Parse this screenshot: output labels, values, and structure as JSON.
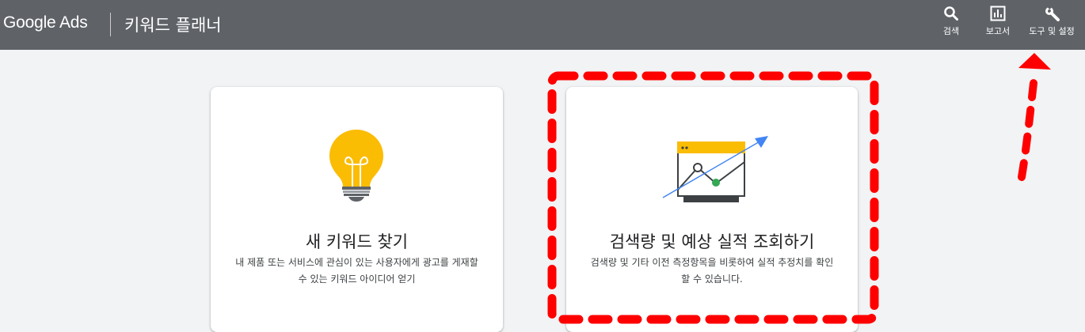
{
  "header": {
    "brand": "Google Ads",
    "section_title": "키워드 플래너",
    "tools": [
      {
        "label": "검색",
        "icon": "search-icon"
      },
      {
        "label": "보고서",
        "icon": "bar-chart-icon"
      },
      {
        "label": "도구 및 설정",
        "icon": "wrench-icon"
      }
    ]
  },
  "cards": [
    {
      "title": "새 키워드 찾기",
      "description": "내 제품 또는 서비스에 관심이 있는 사용자에게 광고를 게재할 수 있는 키워드 아이디어 얻기",
      "icon": "lightbulb-icon"
    },
    {
      "title": "검색량 및 예상 실적 조회하기",
      "description": "검색량 및 기타 이전 측정항목을 비롯하여 실적 추정치를 확인할 수 있습니다.",
      "icon": "trend-chart-icon"
    }
  ],
  "annotations": {
    "highlight_color": "#ff0000"
  },
  "colors": {
    "topbar": "#5f6368",
    "bulb": "#fbbc04",
    "arrow_blue": "#4285f4",
    "point_green": "#34a853"
  }
}
